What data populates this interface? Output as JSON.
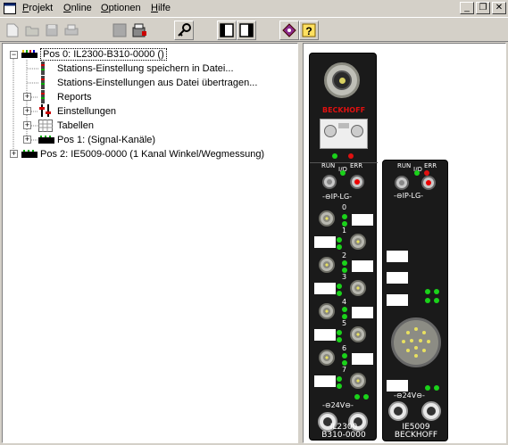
{
  "menubar": {
    "items": [
      {
        "label": "Projekt",
        "underline": "P"
      },
      {
        "label": "Online",
        "underline": "O"
      },
      {
        "label": "Optionen",
        "underline": "O"
      },
      {
        "label": "Hilfe",
        "underline": "H"
      }
    ],
    "window_buttons": [
      "_",
      "❐",
      "✕"
    ]
  },
  "tree": {
    "rows": [
      {
        "text": "Pos 0: IL2300-B310-0000  ()"
      },
      {
        "text": "Stations-Einstellung speichern in Datei..."
      },
      {
        "text": "Stations-Einstellungen aus Datei übertragen..."
      },
      {
        "text": "Reports"
      },
      {
        "text": "Einstellungen"
      },
      {
        "text": "Tabellen"
      },
      {
        "text": "Pos 1:    (Signal-Kanäle)"
      },
      {
        "text": "Pos 2: IE5009-0000  (1 Kanal Winkel/Wegmessung)"
      }
    ]
  },
  "module1": {
    "brand": "BECKHOFF",
    "run_label": "RUN",
    "io_label": "I/O",
    "err_label": "ERR",
    "ip_label": "-⊖IP-LG-",
    "power_label": "-⊖24V⊖-",
    "channels": [
      "0",
      "1",
      "2",
      "3",
      "4",
      "5",
      "6",
      "7"
    ],
    "name": "IL2300",
    "subname": "B310-0000"
  },
  "module2": {
    "run_label": "RUN",
    "io_label": "I/O",
    "err_label": "ERR",
    "ip_label": "-⊖IP-LG-",
    "power_label": "-⊖24V⊖-",
    "name": "IE5009",
    "brand": "BECKHOFF"
  },
  "colors": {
    "led_green": "#1ad21a",
    "led_red": "#e01010",
    "module_bg": "#1a1a1a"
  }
}
